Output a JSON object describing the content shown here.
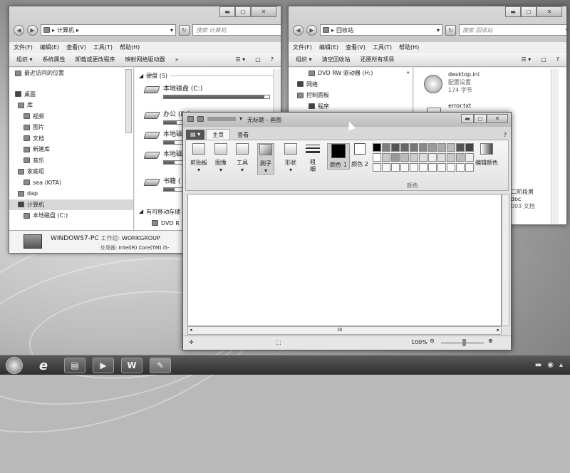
{
  "left_explorer": {
    "address": [
      "计算机"
    ],
    "search_placeholder": "搜索 计算机",
    "menu": [
      "文件(F)",
      "编辑(E)",
      "查看(V)",
      "工具(T)",
      "帮助(H)"
    ],
    "commands": [
      "组织 ▾",
      "系统属性",
      "卸载或更改程序",
      "映射网络驱动器",
      "»"
    ],
    "nav_items": [
      "最近访问的位置",
      "桌面",
      "库",
      "视频",
      "图片",
      "文档",
      "新建库",
      "音乐",
      "家庭组",
      "sea (KITA)",
      "dap",
      "计算机",
      "本地磁盘 (C:)"
    ],
    "section_hdd": "硬盘 (5)",
    "drives": [
      {
        "label": "本地磁盘 (C:)",
        "fill": 0.95
      },
      {
        "label": "办公 (D:)",
        "fill": 0.12
      },
      {
        "label": "本地磁",
        "fill": 0.1
      },
      {
        "label": "本地磁",
        "fill": 0.1
      },
      {
        "label": "书籍 (",
        "fill": 0.1
      }
    ],
    "section_removable": "有可移动存储",
    "dvd_partial": "DVD R",
    "details": {
      "name": "WINDOWS7-PC",
      "wg_label": "工作组:",
      "wg_value": "WORKGROUP",
      "cpu_label": "处理器:",
      "cpu_value": "Intel(R) Core(TM) i5-"
    }
  },
  "right_explorer": {
    "address": [
      "回收站"
    ],
    "search_placeholder": "搜索 回收站",
    "menu": [
      "文件(F)",
      "编辑(E)",
      "查看(V)",
      "工具(T)",
      "帮助(H)"
    ],
    "commands": [
      "组织 ▾",
      "清空回收站",
      "还原所有项目"
    ],
    "nav_items": [
      "DVD RW 驱动器 (H:)",
      "网络",
      "控制面板",
      "程序"
    ],
    "files": [
      {
        "name": "desktop.ini",
        "line1": "配置设置",
        "line2": "174 字节"
      },
      {
        "name": "error.txt",
        "line1": "",
        "line2": ""
      }
    ],
    "partial_file": {
      "line1": "二阶段男",
      "line2": "doc",
      "line3": "003 文档"
    }
  },
  "paint": {
    "title": "无标题 - 画图",
    "tabs": [
      "主页",
      "查看"
    ],
    "groups": [
      "剪贴板",
      "图像",
      "工具",
      "刷子",
      "形状",
      "粗细",
      "颜色 1",
      "颜色 2",
      "编辑颜色"
    ],
    "colors_label": "颜色",
    "zoom": "100%",
    "scroll_mark": "III",
    "palette": [
      "#000000",
      "#7f7f7f",
      "#555555",
      "#666666",
      "#777777",
      "#888888",
      "#999999",
      "#aaaaaa",
      "#bbbbbb",
      "#555555",
      "#444444",
      "#ffffff",
      "#c8c8c8",
      "#999999",
      "#bbbbbb",
      "#cccccc",
      "#dddddd",
      "#eeeeee",
      "#dddddd",
      "#cccccc",
      "#bbbbbb",
      "#eeeeee"
    ]
  },
  "taskbar": {
    "buttons": [
      "start-orb",
      "ie",
      "explorer",
      "media",
      "word",
      "paint"
    ],
    "tray": [
      "▬",
      "◉",
      "▴"
    ]
  }
}
